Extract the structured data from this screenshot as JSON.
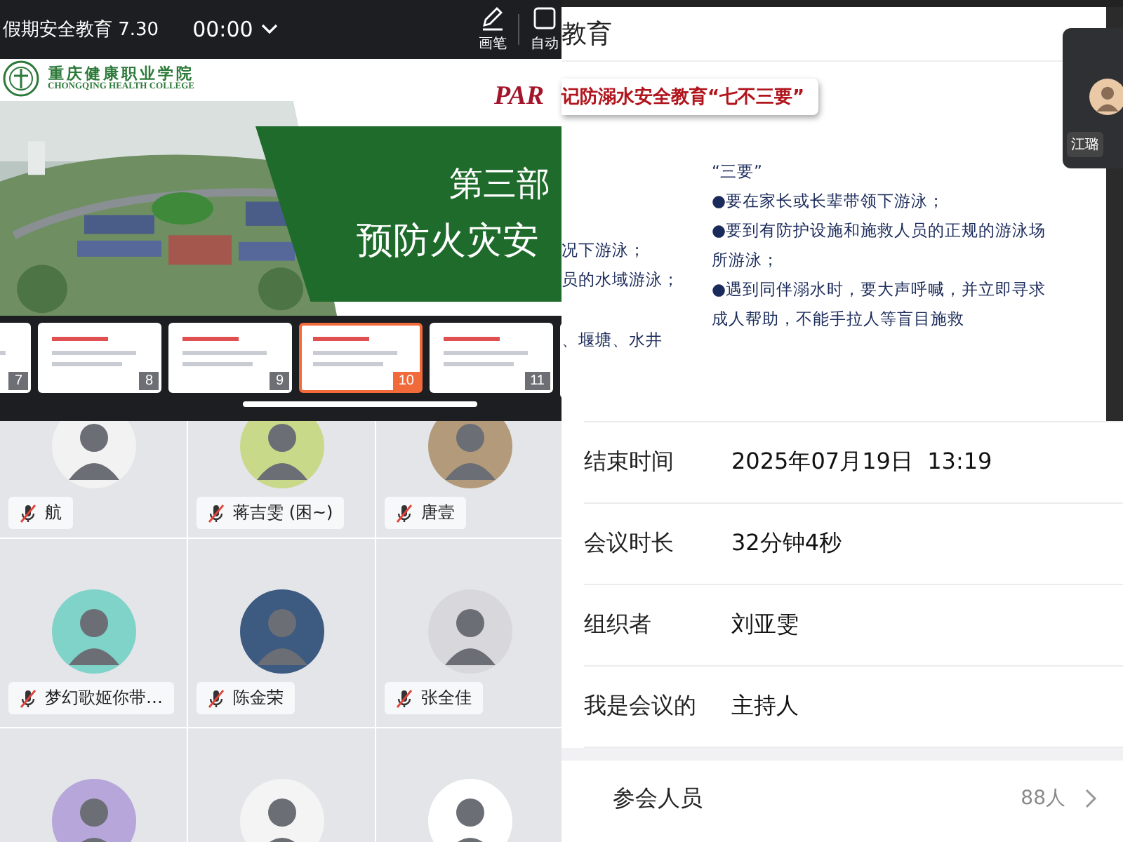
{
  "presenter": {
    "title": "假期安全教育 7.30",
    "timer": "00:00",
    "tools": [
      {
        "kind": "pen",
        "label": "画笔"
      },
      {
        "kind": "auto",
        "label": "自动"
      }
    ]
  },
  "slide": {
    "school_name": "重庆健康职业学院",
    "school_name_en": "CHONGQING HEALTH COLLEGE",
    "part": "PAR",
    "heading": "第三部",
    "subheading": "预防火灾安"
  },
  "thumbnails": [
    {
      "number": "7",
      "selected": false
    },
    {
      "number": "8",
      "selected": false
    },
    {
      "number": "9",
      "selected": false
    },
    {
      "number": "10",
      "selected": true
    },
    {
      "number": "11",
      "selected": false
    }
  ],
  "participants": [
    {
      "kind": "named",
      "name": "航",
      "muted": true
    },
    {
      "kind": "named",
      "name": "蒋吉雯 (困~)",
      "muted": true
    },
    {
      "kind": "named",
      "name": "唐壹",
      "muted": true
    },
    {
      "kind": "named",
      "name": "梦幻歌姬你带…",
      "muted": true
    },
    {
      "kind": "named",
      "name": "陈金荣",
      "muted": true
    },
    {
      "kind": "named",
      "name": "张全佳",
      "muted": true
    },
    {
      "kind": "partial"
    },
    {
      "kind": "partial"
    },
    {
      "kind": "partial"
    }
  ],
  "doc_slide": {
    "header": "教育",
    "title": "记防溺水安全教育“七不三要”",
    "left_lines": [
      "况下游泳；",
      "员的水域游泳；",
      "、堰塘、水井"
    ],
    "right_heading": "“三要”",
    "right_items": [
      "●要在家长或长辈带领下游泳；",
      "●要到有防护设施和施救人员的正规的游泳场所游泳；",
      "●遇到同伴溺水时，要大声呼喊，并立即寻求成人帮助，不能手拉人等盲目施救"
    ]
  },
  "video_tile": {
    "name": "江璐"
  },
  "meeting_info": {
    "rows": [
      {
        "label": "结束时间",
        "value": "2025年07月19日  13:19"
      },
      {
        "label": "会议时长",
        "value": "32分钟4秒"
      },
      {
        "label": "组织者",
        "value": "刘亚雯"
      },
      {
        "label": "我是会议的",
        "value": "主持人"
      }
    ],
    "attendees": {
      "label": "参会人员",
      "count": "88人"
    }
  }
}
